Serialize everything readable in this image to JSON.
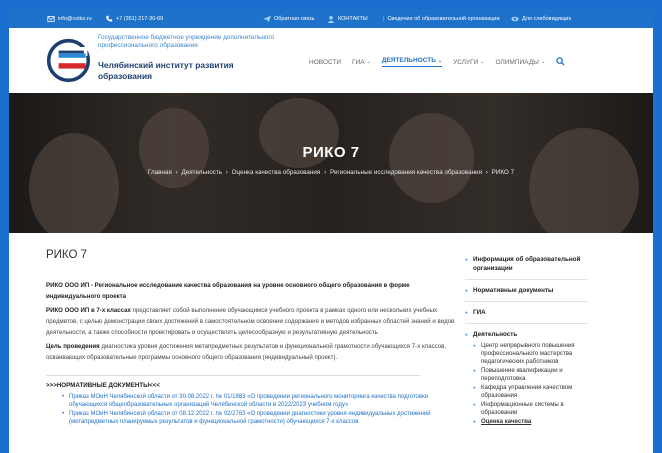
{
  "topbar": {
    "email": "info@coiko.ru",
    "phone": "+7 (351) 217-30-69",
    "feedback": "Обратная связь",
    "contacts": "КОНТАКТЫ",
    "org_info": "Сведения об образовательной организации",
    "accessibility": "Для слабовидящих"
  },
  "header": {
    "org_subtitle": "Государственное бюджетное учреждение дополнительного профессионального образования",
    "org_name": "Челябинский институт развития образования",
    "nav": [
      "НОВОСТИ",
      "ГИА",
      "ДЕЯТЕЛЬНОСТЬ",
      "УСЛУГИ",
      "ОЛИМПИАДЫ"
    ]
  },
  "hero": {
    "title": "РИКО 7",
    "breadcrumbs": [
      "Главная",
      "Деятельность",
      "Оценка качества образования",
      "Региональные исследования качества образования",
      "РИКО 7"
    ]
  },
  "content": {
    "heading": "РИКО 7",
    "p1": "РИКО ООО ИП - Региональное исследование качества образования на уровне основного общего образования в форме индивидуального проекта",
    "p2_bold": "РИКО ООО ИП в 7-х классах",
    "p2_rest": " представляет собой выполнение обучающимся учебного проекта в рамках одного или нескольких учебных предметов, с целью демонстрации своих достижений в  самостоятельном освоении содержания и методов избранных областей знаний и видов деятельности, а также способности проектировать и осуществлять целесообразную и результативную деятельность",
    "p3_bold": "Цель проведения",
    "p3_rest": " диагностика уровня достижения метапредметных результатов и функциональной грамотности обучающихся 7-х классов, осваивающих образовательные программы основного общего образования (индивидуальный проект).",
    "norm_title": ">>>НОРМАТИВНЫЕ ДОКУМЕНТЫ<<<",
    "links": [
      "Приказ МОиН Челябинской области от 30.08.2022 г. № 01/1883 «О проведении регионального мониторинга качества подготовки обучающихся общеобразовательных организаций Челябинской области в 2022/2023 учебном году»",
      "Приказ МОиН Челябинской области от 08.12.2022 г. № 02/2763 «О проведении диагностики уровня индивидуальных достижений (метапредметных планируемых результатов и функциональной грамотности) обучающихся 7-х классов"
    ]
  },
  "sidebar": {
    "items": [
      "Информация об образовательной организации",
      "Нормативные документы",
      "ГИА",
      "Деятельность"
    ],
    "sub": [
      "Центр непрерывного повышения профессионального мастерства педагогических работников",
      "Повышение квалификации и переподготовка",
      "Кафедра управления качеством образования",
      "Информационные системы в образовании",
      "Оценка качества"
    ]
  },
  "colors": {
    "brand": "#1e72c9",
    "accent_red": "#d62a2a",
    "dark_blue": "#1e3f70"
  }
}
